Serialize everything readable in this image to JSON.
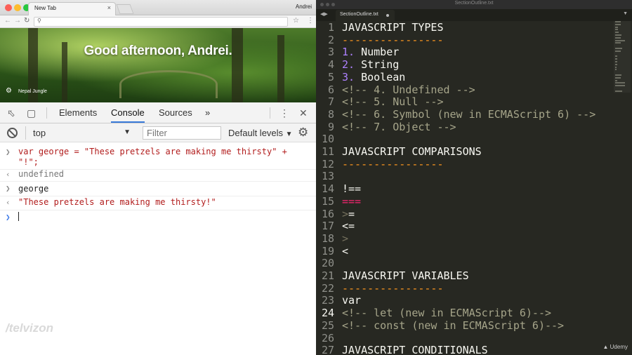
{
  "browser": {
    "tab_title": "New Tab",
    "tab_close": "×",
    "profile_name": "Andrei",
    "icons": [
      "back-arrow-icon",
      "forward-arrow-icon",
      "reload-icon",
      "search-icon",
      "star-icon",
      "kebab-menu-icon"
    ],
    "newtab": {
      "greeting": "Good afternoon, Andrei.",
      "photo_credit": "Nepal Jungle"
    }
  },
  "devtools": {
    "tabs": [
      "Elements",
      "Console",
      "Sources"
    ],
    "active_tab": "Console",
    "more_tabs": "»",
    "context": "top",
    "filter_placeholder": "Filter",
    "levels": "Default levels",
    "console_lines": [
      {
        "kind": "input",
        "text_1": "var george = \"These pretzels are making me thirsty\" +",
        "text_2": "\"!\";"
      },
      {
        "kind": "output",
        "text": "undefined"
      },
      {
        "kind": "input",
        "text": "george"
      },
      {
        "kind": "output",
        "text": "\"These pretzels are making me thirsty!\""
      }
    ]
  },
  "watermark": "/telvizon",
  "editor": {
    "window_title": "SectionOutline.txt",
    "tab_label": "SectionOutline.txt",
    "current_line": 24,
    "lines": [
      {
        "n": "1",
        "text": "JAVASCRIPT TYPES"
      },
      {
        "n": "2",
        "text": "----------------"
      },
      {
        "n": "3",
        "num": "1.",
        "text": " Number"
      },
      {
        "n": "4",
        "num": "2.",
        "text": " String"
      },
      {
        "n": "5",
        "num": "3.",
        "text": " Boolean"
      },
      {
        "n": "6",
        "text": "<!-- 4. Undefined -->"
      },
      {
        "n": "7",
        "text": "<!-- 5. Null -->"
      },
      {
        "n": "8",
        "text": "<!-- 6. Symbol (new in ECMAScript 6) -->"
      },
      {
        "n": "9",
        "text": "<!-- 7. Object -->"
      },
      {
        "n": "10",
        "text": ""
      },
      {
        "n": "11",
        "text": "JAVASCRIPT COMPARISONS"
      },
      {
        "n": "12",
        "text": "----------------"
      },
      {
        "n": "13",
        "text": ""
      },
      {
        "n": "14",
        "text": "!=="
      },
      {
        "n": "15",
        "text": "==="
      },
      {
        "n": "16",
        "text": ">="
      },
      {
        "n": "17",
        "text": "<="
      },
      {
        "n": "18",
        "text": ">"
      },
      {
        "n": "19",
        "text": "<"
      },
      {
        "n": "20",
        "text": ""
      },
      {
        "n": "21",
        "text": "JAVASCRIPT VARIABLES"
      },
      {
        "n": "22",
        "text": "----------------"
      },
      {
        "n": "23",
        "text": "var"
      },
      {
        "n": "24",
        "text": "<!-- let (new in ECMAScript 6)-->"
      },
      {
        "n": "25",
        "text": "<!-- const (new in ECMAScript 6)-->"
      },
      {
        "n": "26",
        "text": ""
      },
      {
        "n": "27",
        "text": "JAVASCRIPT CONDITIONALS"
      }
    ],
    "brand": "Udemy"
  }
}
